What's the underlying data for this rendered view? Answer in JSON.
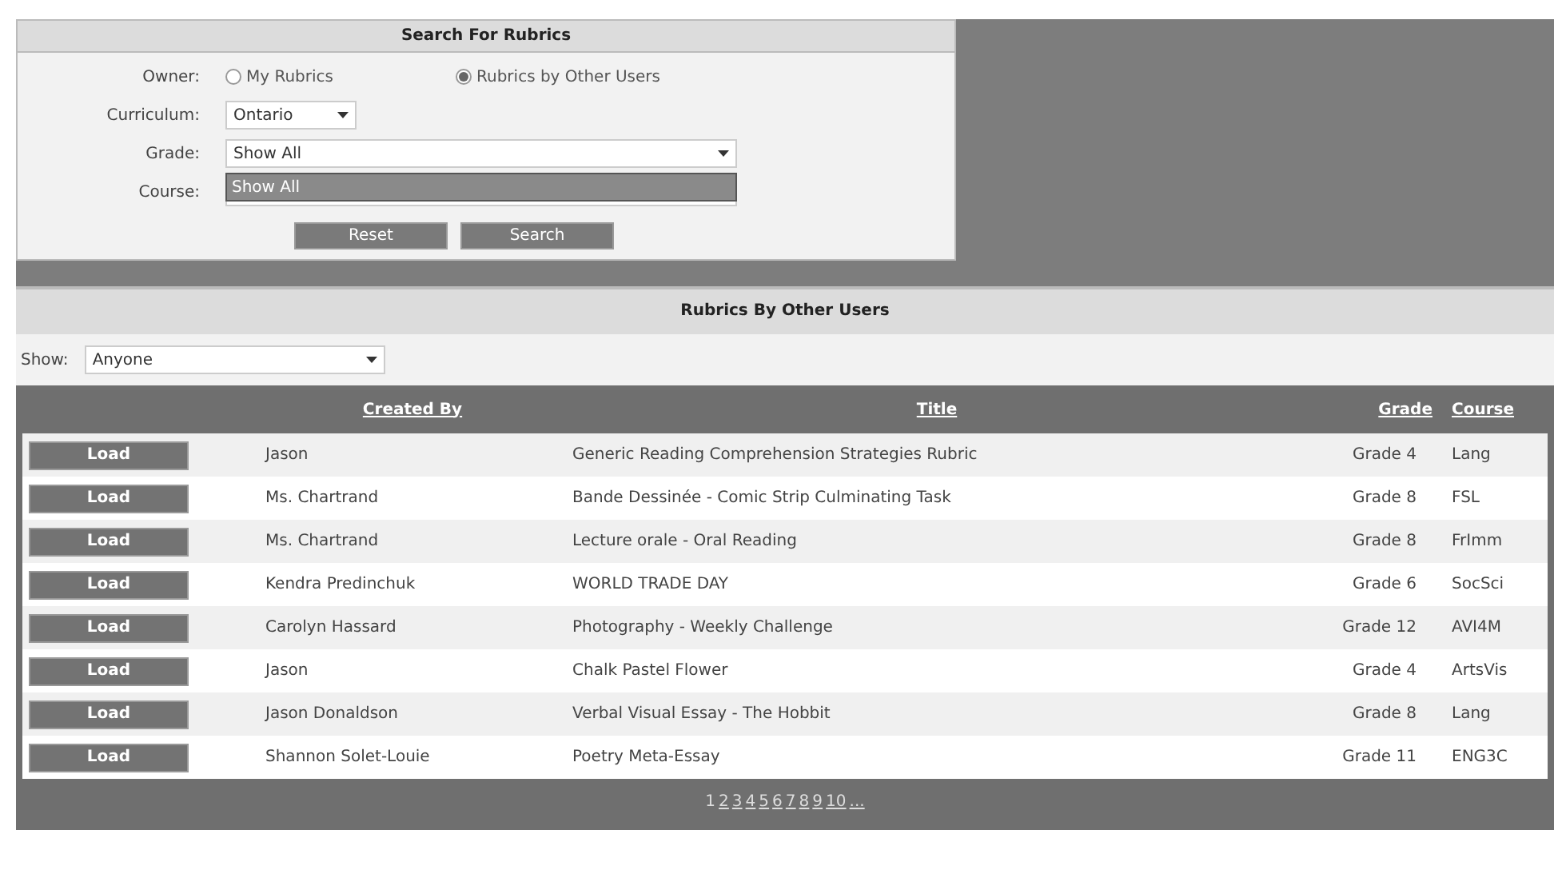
{
  "search_panel": {
    "title": "Search For Rubrics",
    "owner": {
      "label": "Owner:",
      "options": [
        {
          "label": "My Rubrics",
          "selected": false
        },
        {
          "label": "Rubrics by Other Users",
          "selected": true
        }
      ]
    },
    "curriculum": {
      "label": "Curriculum:",
      "value": "Ontario"
    },
    "grade": {
      "label": "Grade:",
      "value": "Show All",
      "expanded": true,
      "open_options": [
        {
          "label": "Show All",
          "selected": true
        }
      ]
    },
    "course": {
      "label": "Course:"
    },
    "buttons": [
      "Reset",
      "Search"
    ]
  },
  "results": {
    "title": "Rubrics By Other Users",
    "show": {
      "label": "Show:",
      "value": "Anyone"
    },
    "columns": [
      "Created By",
      "Title",
      "Grade",
      "Course"
    ],
    "rows": [
      {
        "action": "Load",
        "created_by": "Jason",
        "title": "Generic Reading Comprehension Strategies Rubric",
        "grade": "Grade 4",
        "course": "Lang"
      },
      {
        "action": "Load",
        "created_by": "Ms. Chartrand",
        "title": "Bande Dessinée - Comic Strip Culminating Task",
        "grade": "Grade 8",
        "course": "FSL"
      },
      {
        "action": "Load",
        "created_by": "Ms. Chartrand",
        "title": "Lecture orale - Oral Reading",
        "grade": "Grade 8",
        "course": "FrImm"
      },
      {
        "action": "Load",
        "created_by": "Kendra Predinchuk",
        "title": "WORLD TRADE DAY",
        "grade": "Grade 6",
        "course": "SocSci"
      },
      {
        "action": "Load",
        "created_by": "Carolyn Hassard",
        "title": "Photography - Weekly Challenge",
        "grade": "Grade 12",
        "course": "AVI4M"
      },
      {
        "action": "Load",
        "created_by": "Jason",
        "title": "Chalk Pastel Flower",
        "grade": "Grade 4",
        "course": "ArtsVis"
      },
      {
        "action": "Load",
        "created_by": "Jason Donaldson",
        "title": "Verbal Visual Essay - The Hobbit",
        "grade": "Grade 8",
        "course": "Lang"
      },
      {
        "action": "Load",
        "created_by": "Shannon Solet-Louie",
        "title": "Poetry Meta-Essay",
        "grade": "Grade 11",
        "course": "ENG3C"
      }
    ],
    "pages": [
      {
        "label": "1",
        "selected": true
      },
      {
        "label": "2",
        "selected": false
      },
      {
        "label": "3",
        "selected": false
      },
      {
        "label": "4",
        "selected": false
      },
      {
        "label": "5",
        "selected": false
      },
      {
        "label": "6",
        "selected": false
      },
      {
        "label": "7",
        "selected": false
      },
      {
        "label": "8",
        "selected": false
      },
      {
        "label": "9",
        "selected": false
      },
      {
        "label": "10",
        "selected": false
      },
      {
        "label": "...",
        "selected": false
      }
    ]
  }
}
